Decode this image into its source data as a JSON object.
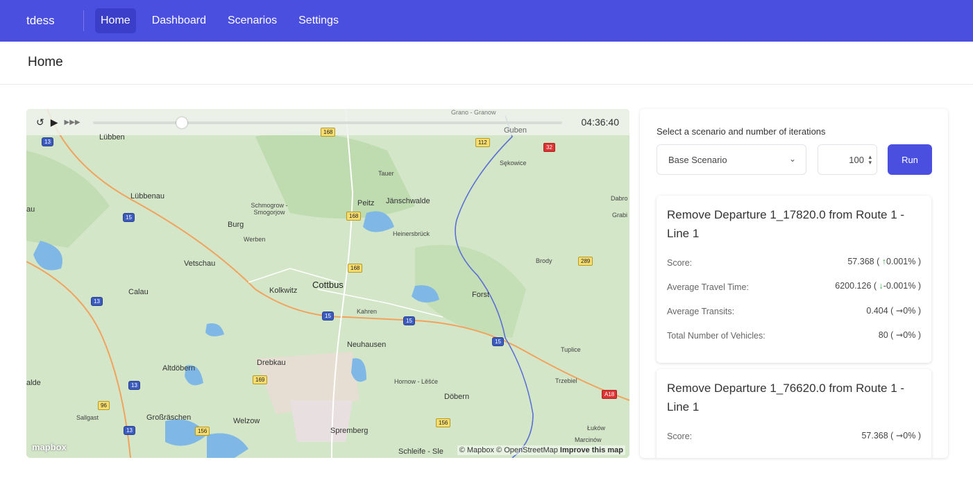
{
  "nav": {
    "brand": "tdess",
    "links": [
      "Home",
      "Dashboard",
      "Scenarios",
      "Settings"
    ]
  },
  "page_title": "Home",
  "player": {
    "time": "04:36:40",
    "progress": 0.19
  },
  "map": {
    "labels": [
      "Lübben",
      "Lübbenau",
      "Burg",
      "Werben",
      "Schmogrow - Smogorjow",
      "Tauer",
      "Peitz",
      "Jänschwalde",
      "Heinersbrück",
      "Guben",
      "Sękowice",
      "Dabro",
      "Grabi",
      "Forst",
      "Brody",
      "Vetschau",
      "Calau",
      "Kolkwitz",
      "Cottbus",
      "Kahren",
      "Neuhausen",
      "Drebkau",
      "Altdöbern",
      "Hornow - Lěšće",
      "Döbern",
      "Tuplice",
      "Trzebiel",
      "Großräschen",
      "Sallgast",
      "Welzow",
      "Spremberg",
      "Łuków",
      "Marcinów",
      "Grano - Granow",
      "alde",
      "au",
      "Schleife - Sle"
    ],
    "road_shields": [
      "13",
      "15",
      "168",
      "112",
      "32",
      "289",
      "169",
      "96",
      "156",
      "A18"
    ],
    "logo": "mapbox",
    "attribution": "© Mapbox © OpenStreetMap",
    "improve_link": "Improve this map"
  },
  "panel": {
    "label": "Select a scenario and number of iterations",
    "scenario": "Base Scenario",
    "iterations": "100",
    "run_label": "Run",
    "cards": [
      {
        "title": "Remove Departure 1_17820.0 from Route 1 - Line 1",
        "metrics": [
          {
            "label": "Score:",
            "value": "57.368 (",
            "arrow": "↑",
            "change": "0.001% )"
          },
          {
            "label": "Average Travel Time:",
            "value": "6200.126 (",
            "arrow": "↓",
            "change": "-0.001% )"
          },
          {
            "label": "Average Transits:",
            "value": "0.404 (",
            "arrow": "➞",
            "change": "0% )"
          },
          {
            "label": "Total Number of Vehicles:",
            "value": "80 (",
            "arrow": "➞",
            "change": "0% )"
          }
        ]
      },
      {
        "title": "Remove Departure 1_76620.0 from Route 1 - Line 1",
        "metrics": [
          {
            "label": "Score:",
            "value": "57.368 (",
            "arrow": "➞",
            "change": "0% )"
          }
        ]
      }
    ]
  },
  "colors": {
    "primary": "#4b4fe0",
    "map_land": "#cfe3c4",
    "road": "#f2a25c",
    "border_line": "#5b6fd6",
    "water": "#7fb8e6"
  }
}
